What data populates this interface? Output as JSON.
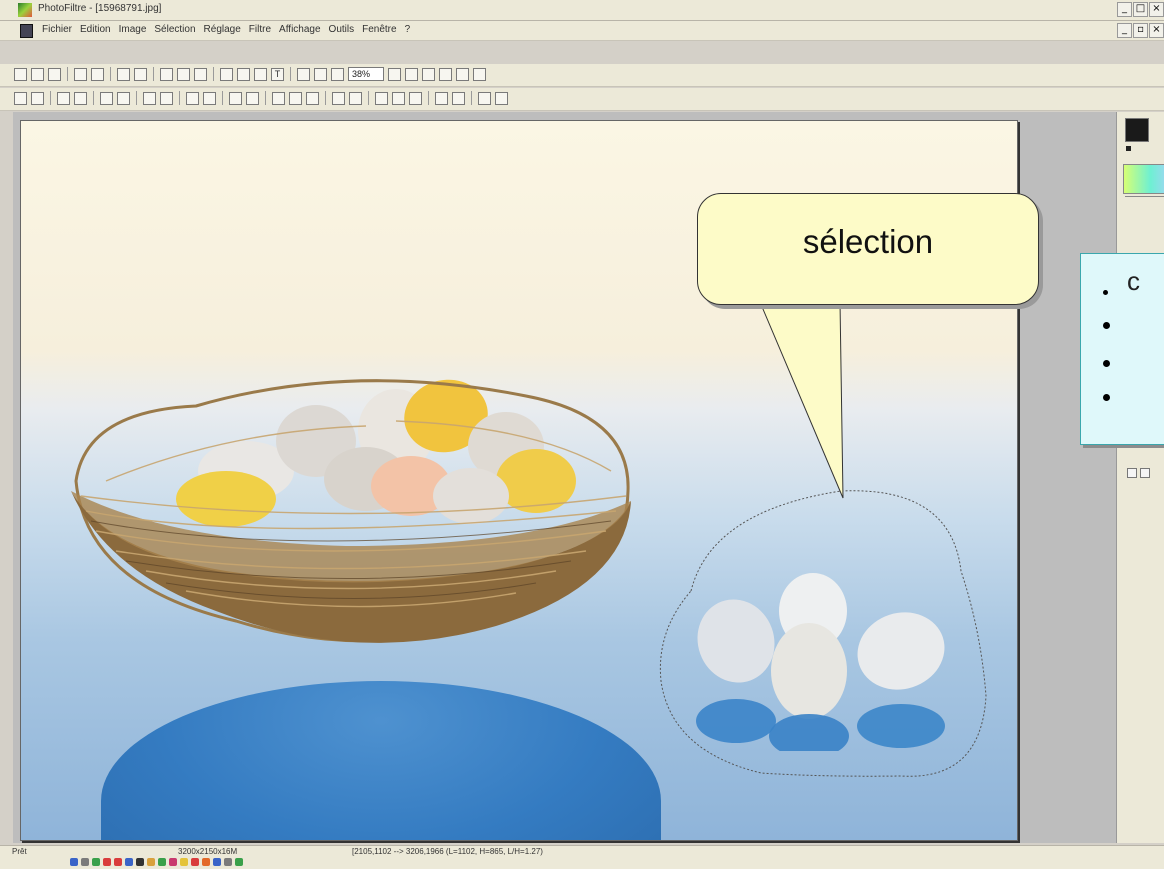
{
  "window": {
    "title": "PhotoFiltre - [15968791.jpg]",
    "controls": [
      "_",
      "□",
      "×"
    ]
  },
  "menubar": {
    "items": [
      "Fichier",
      "Edition",
      "Image",
      "Sélection",
      "Réglage",
      "Filtre",
      "Affichage",
      "Outils",
      "Fenêtre",
      "?"
    ],
    "doc_controls": [
      "_",
      "▫",
      "×"
    ]
  },
  "toolbar": {
    "zoom_value": "38%"
  },
  "callout": {
    "text": "sélection"
  },
  "infobox": {
    "first_glyph": "c"
  },
  "status": {
    "left": "Prêt",
    "size": "3200x2150x16M",
    "coords": "[2105,1102 --> 3206,1966 (L=1102, H=865, L/H=1.27)"
  },
  "colors": {
    "callout_fill": "#fdfbc8",
    "infobox_fill": "#dff8fa",
    "infobox_border": "#3aa7ad"
  }
}
